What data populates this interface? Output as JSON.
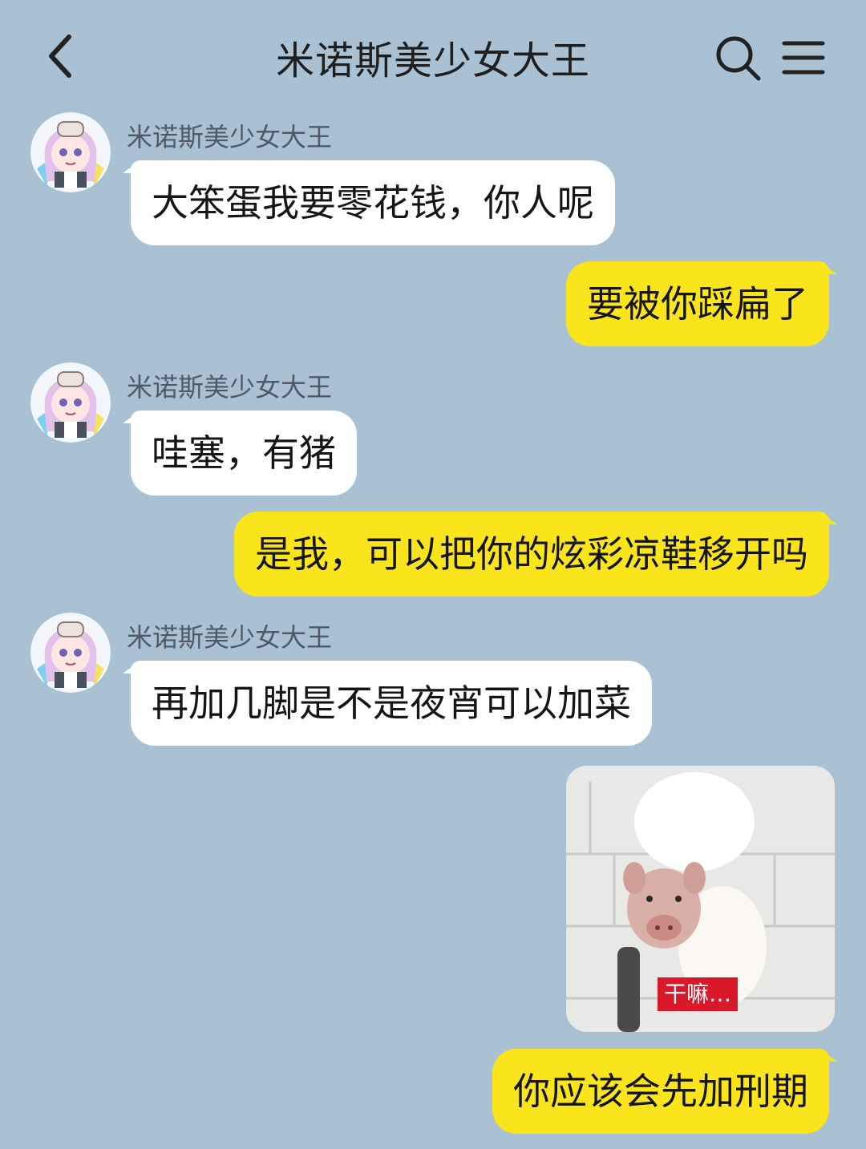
{
  "header": {
    "title": "米诺斯美少女大王",
    "back_icon": "chevron-left-icon",
    "search_icon": "search-icon",
    "menu_icon": "menu-icon"
  },
  "contact": {
    "name": "米诺斯美少女大王"
  },
  "colors": {
    "background": "#aac0d3",
    "incoming_bubble": "#ffffff",
    "outgoing_bubble": "#fae51c",
    "caption_bg": "#d9182a"
  },
  "messages": [
    {
      "side": "left",
      "sender": "米诺斯美少女大王",
      "text": "大笨蛋我要零花钱，你人呢"
    },
    {
      "side": "right",
      "text": "要被你踩扁了"
    },
    {
      "side": "left",
      "sender": "米诺斯美少女大王",
      "text": "哇塞，有猪"
    },
    {
      "side": "right",
      "text": "是我，可以把你的炫彩凉鞋移开吗"
    },
    {
      "side": "left",
      "sender": "米诺斯美少女大王",
      "text": "再加几脚是不是夜宵可以加菜"
    },
    {
      "side": "right",
      "type": "image",
      "caption": "干嘛…"
    },
    {
      "side": "right",
      "text": "你应该会先加刑期"
    }
  ]
}
